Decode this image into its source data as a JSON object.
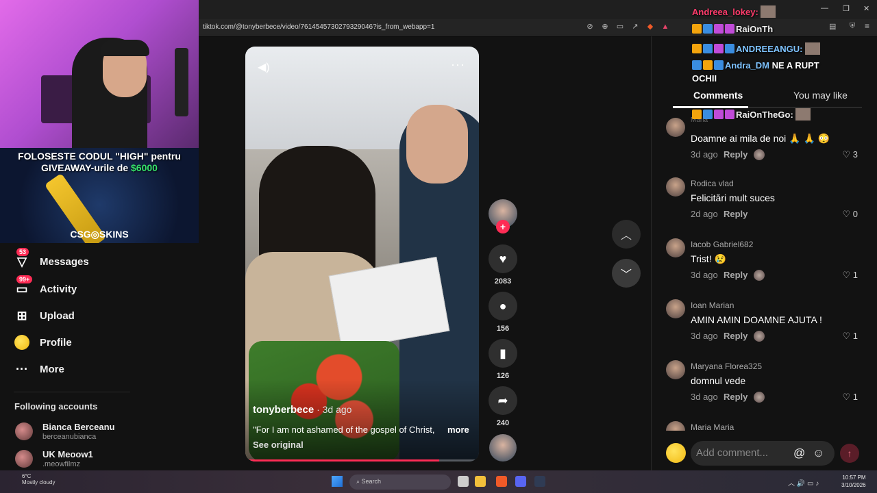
{
  "browser": {
    "url": "tiktok.com/@tonyberbece/video/7614545730279329046?is_from_webapp=1"
  },
  "stream_overlay": {
    "promo_line1": "FOLOSESTE CODUL \"HIGH\" pentru",
    "promo_line2_prefix": "GIVEAWAY-urile de ",
    "promo_amount": "$6000",
    "promo_brand": "CSG◎SKINS"
  },
  "nav": {
    "items": [
      {
        "label": "Messages",
        "badge": "53",
        "icon": "messages-icon"
      },
      {
        "label": "Activity",
        "badge": "99+",
        "icon": "activity-icon"
      },
      {
        "label": "Upload",
        "icon": "upload-icon"
      },
      {
        "label": "Profile",
        "icon": "profile-icon"
      },
      {
        "label": "More",
        "icon": "more-icon"
      }
    ],
    "following_title": "Following accounts",
    "accounts": [
      {
        "name": "Bianca Berceanu",
        "handle": "berceanubianca"
      },
      {
        "name": "UK Meoow1",
        "handle": ".meowfilmz"
      }
    ]
  },
  "video": {
    "author": "tonyberbece",
    "ago": " · 3d ago",
    "caption": "\"For I am not ashamed of the gospel of Christ,",
    "more": "more",
    "see_original": "See original",
    "progress": 0.83
  },
  "actions": {
    "likes": "2083",
    "comments": "156",
    "saves": "126",
    "shares": "240"
  },
  "comments_panel": {
    "tab_comments": "Comments",
    "tab_you_may_like": "You may like",
    "comments": [
      {
        "user": "Maria",
        "text": "Doamne ai mila de noi 🙏 🙏 😳",
        "time": "3d ago",
        "likes": "3"
      },
      {
        "user": "Rodica vlad",
        "text": "Felicitări mult suces",
        "time": "2d ago",
        "likes": "0"
      },
      {
        "user": "Iacob Gabriel682",
        "text": "Trist! 😢",
        "time": "3d ago",
        "likes": "1"
      },
      {
        "user": "Ioan Marian",
        "text": "AMIN AMIN DOAMNE AJUTA !",
        "time": "3d ago",
        "likes": "1"
      },
      {
        "user": "Maryana Florea325",
        "text": "domnul vede",
        "time": "3d ago",
        "likes": "1"
      },
      {
        "user": "Maria Maria",
        "text": "",
        "time": "",
        "likes": ""
      }
    ],
    "reply_label": "Reply",
    "add_placeholder": "Add comment..."
  },
  "chat": [
    {
      "user": "Andreea_lokey:",
      "msg": ""
    },
    {
      "user": "RaiOnTh",
      "msg": ""
    },
    {
      "user": "ANDREEANGU:",
      "msg": ""
    },
    {
      "user": "Andra_DM",
      "msg": "NE A RUPT"
    },
    {
      "user": "",
      "msg": "OCHII"
    },
    {
      "user": "Andreea_lokey:",
      "msg": ""
    },
    {
      "user": "RaiOnTheGo:",
      "msg": ""
    }
  ],
  "taskbar": {
    "temp": "6°C",
    "weather": "Mostly cloudy",
    "search": "Search",
    "time": "10:57 PM",
    "date": "3/10/2026"
  }
}
